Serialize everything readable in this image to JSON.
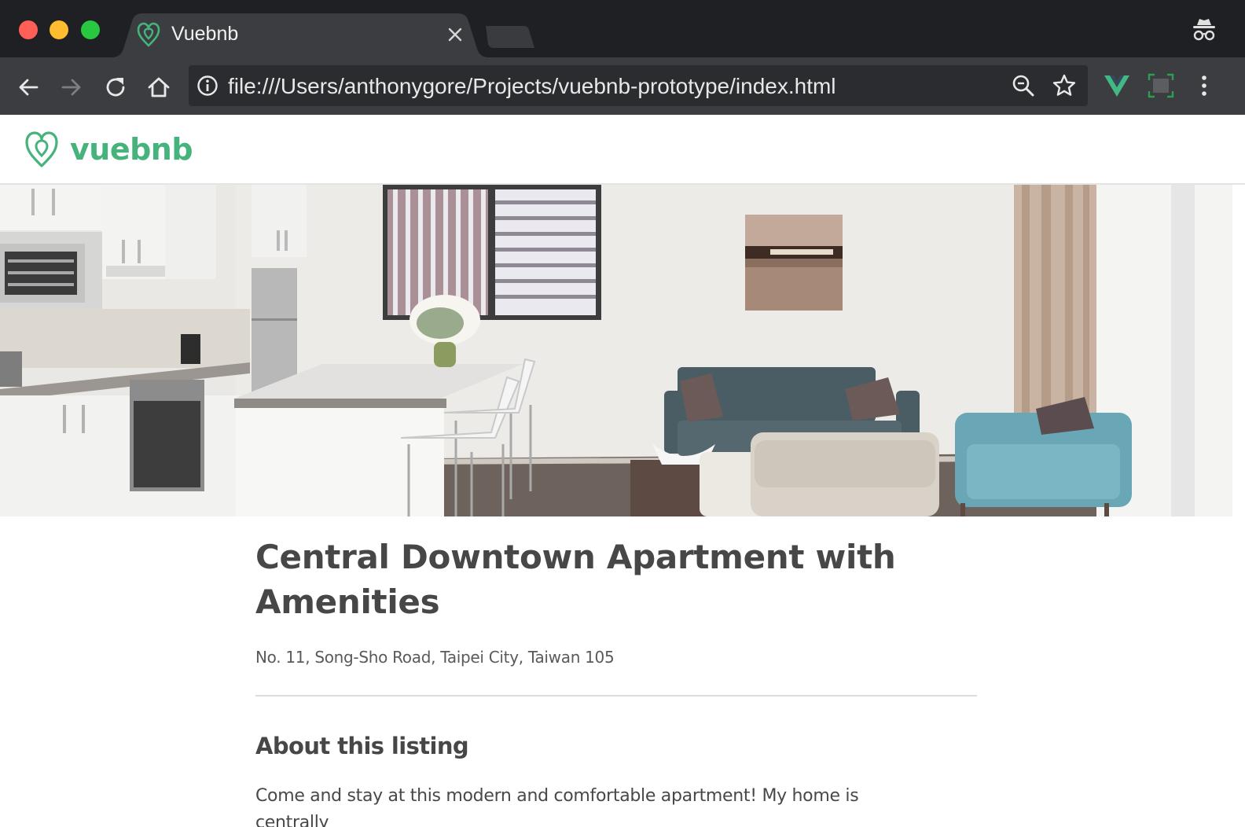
{
  "browser": {
    "tab": {
      "title": "Vuebnb",
      "favicon": "vuebnb-logo-icon",
      "close_icon": "close-icon"
    },
    "new_tab_icon": "new-tab-icon",
    "incognito_icon": "incognito-icon",
    "toolbar": {
      "back_icon": "back-arrow-icon",
      "forward_icon": "forward-arrow-icon",
      "reload_icon": "reload-icon",
      "home_icon": "home-icon",
      "address_bar": {
        "info_icon": "info-icon",
        "url": "file:///Users/anthonygore/Projects/vuebnb-prototype/index.html",
        "zoom_icon": "zoom-icon",
        "bookmark_icon": "star-icon"
      },
      "extensions": [
        "vue-devtools-icon",
        "screen-capture-icon"
      ],
      "menu_icon": "kebab-menu-icon"
    }
  },
  "site": {
    "logo_icon": "vuebnb-logo-icon",
    "name": "vuebnb",
    "brand_color": "#46b37d"
  },
  "listing": {
    "hero_image": "apartment-interior-photo",
    "title": "Central Downtown Apartment with Amenities",
    "address": "No. 11, Song-Sho Road, Taipei City, Taiwan 105",
    "about_heading": "About this listing",
    "about_text": "Come and stay at this modern and comfortable apartment! My home is centrally"
  },
  "colors": {
    "traffic_close": "#ff5f57",
    "traffic_minimize": "#febc2e",
    "traffic_maximize": "#28c840",
    "tab_background": "#3c3d40",
    "titlebar_background": "#1f2023",
    "vue_green": "#42b883"
  }
}
